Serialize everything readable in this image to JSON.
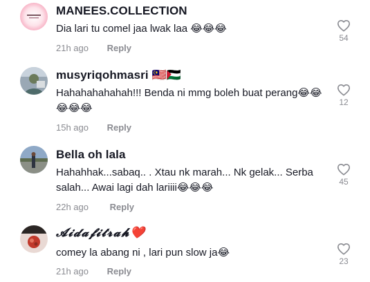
{
  "comments": [
    {
      "username": "MANEES.COLLECTION",
      "text": "Dia lari tu comel jaa lwak laa 😂😂😂",
      "time": "21h ago",
      "reply_label": "Reply",
      "likes": "54",
      "avatar_icon": "brand-logo-avatar"
    },
    {
      "username": "musyriqohmasri 🇲🇾🇵🇸",
      "text": "Hahahahahahah!!! Benda ni mmg boleh buat perang😂😂😂😂😂",
      "time": "15h ago",
      "reply_label": "Reply",
      "likes": "12",
      "avatar_icon": "profile-photo-avatar"
    },
    {
      "username": "Bella oh lala",
      "text": "Hahahhak...sabaq.. . Xtau nk marah... Nk gelak... Serba salah... Awai lagi dah lariiii😂😂😂",
      "time": "22h ago",
      "reply_label": "Reply",
      "likes": "45",
      "avatar_icon": "profile-photo-avatar"
    },
    {
      "username": "𝓐𝓲𝓭𝓪𝓯𝓲𝓽𝓻𝓪𝓱❤️",
      "text": "comey la abang ni , lari pun slow ja😂",
      "time": "21h ago",
      "reply_label": "Reply",
      "likes": "23",
      "avatar_icon": "profile-photo-avatar"
    }
  ],
  "colors": {
    "text": "#161823",
    "muted": "#8a8b91",
    "heart_outline": "#8a8b91"
  }
}
